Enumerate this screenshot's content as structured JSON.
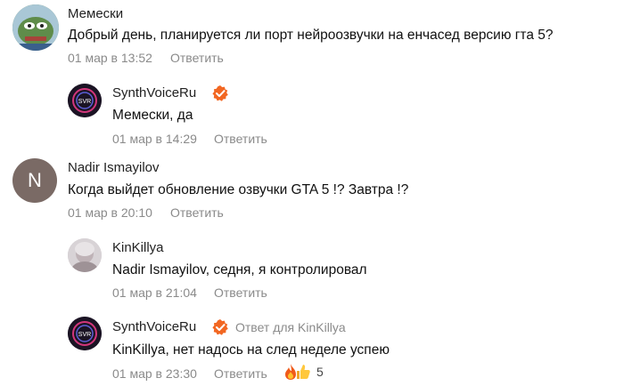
{
  "reply_label": "Ответить",
  "comments": [
    {
      "author": "Мемески",
      "text": "Добрый день, планируется ли порт нейроозвучки на енчасед версию гта 5?",
      "time": "01 мар в 13:52"
    },
    {
      "author": "SynthVoiceRu",
      "text": "Мемески, да",
      "time": "01 мар в 14:29",
      "verified": true
    },
    {
      "author": "Nadir Ismayilov",
      "avatar_letter": "N",
      "text": "Когда выйдет обновление озвучки GTA 5 !? Завтра !?",
      "time": "01 мар в 20:10"
    },
    {
      "author": "KinKillya",
      "text": "Nadir Ismayilov, седня, я контролировал",
      "time": "01 мар в 21:04"
    },
    {
      "author": "SynthVoiceRu",
      "reply_to": "Ответ для KinKillya",
      "text": "KinKillya, нет надось на след неделе успею",
      "time": "01 мар в 23:30",
      "verified": true,
      "reactions": {
        "icons": [
          "fire-icon",
          "thumbs-up-icon"
        ],
        "count": "5"
      }
    }
  ],
  "colors": {
    "meta": "#8a8a8a",
    "verified": "#f26722",
    "letter_avatar": "#7a6a65"
  }
}
